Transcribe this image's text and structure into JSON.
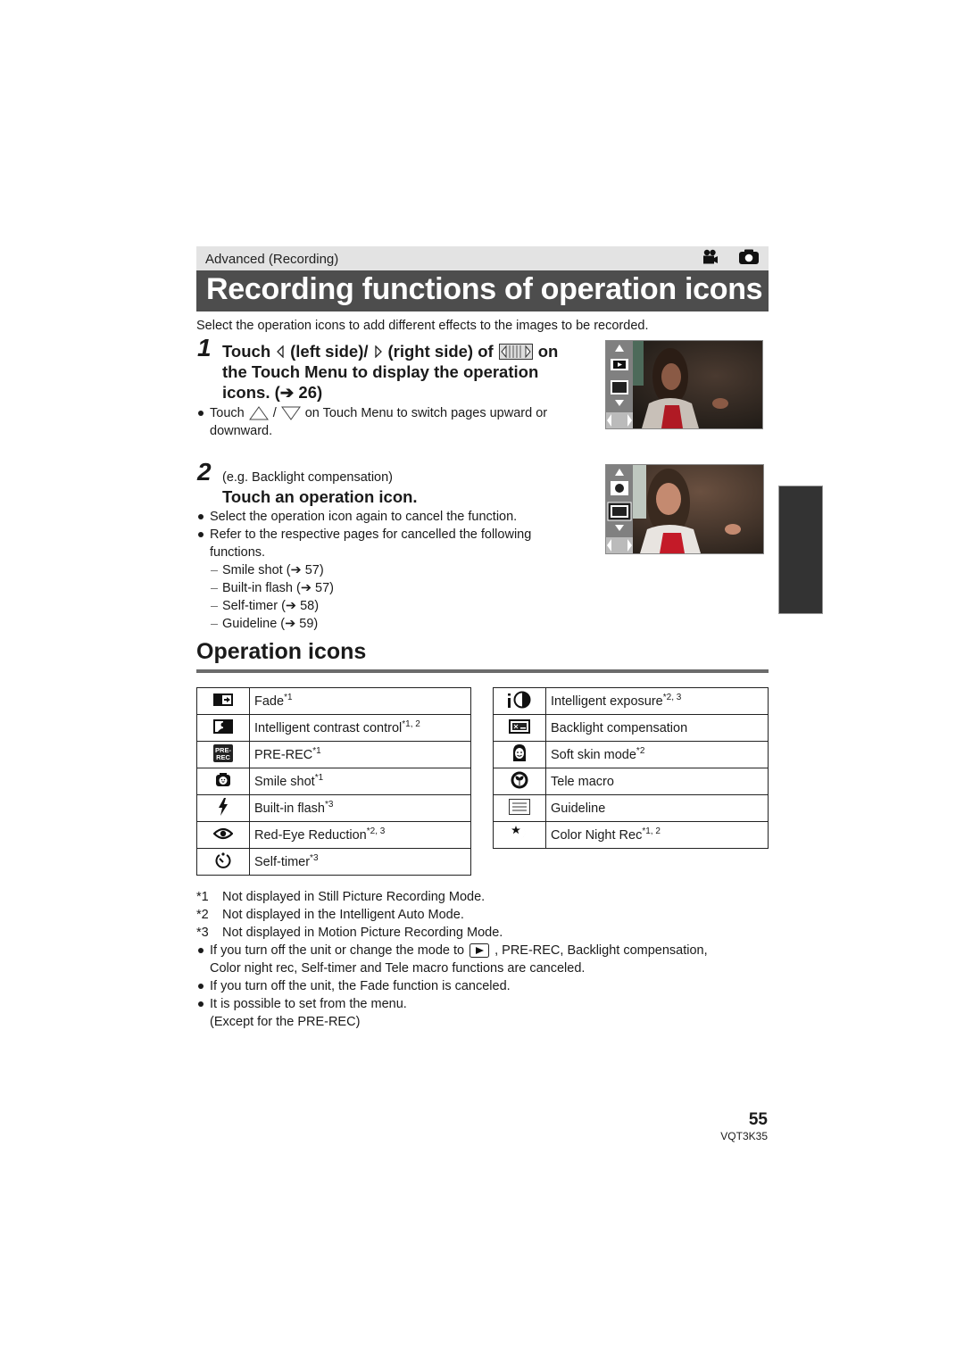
{
  "header": {
    "section": "Advanced (Recording)",
    "mode_icons": [
      "video-camera-icon",
      "still-camera-icon"
    ],
    "title": "Recording functions of operation icons",
    "intro": "Select the operation icons to add different effects to the images to be recorded."
  },
  "step1": {
    "number": "1",
    "line1_a": "Touch",
    "line1_b": "(left side)/",
    "line1_c": "(right side) of",
    "line1_d": "on",
    "line2": "the Touch Menu to display the operation",
    "line3": "icons. (➔ 26)",
    "note_a": "Touch",
    "note_b": "/",
    "note_c": "on Touch Menu to switch pages upward or",
    "note_d": "downward."
  },
  "step2": {
    "number": "2",
    "example": "(e.g. Backlight compensation)",
    "heading": "Touch an operation icon.",
    "bullets": [
      "Select the operation icon again to cancel the function.",
      "Refer to the respective pages for cancelled the following functions."
    ],
    "refs": [
      "Smile shot (➔ 57)",
      "Built-in flash (➔ 57)",
      "Self-timer (➔ 58)",
      "Guideline (➔ 59)"
    ]
  },
  "operation_icons": {
    "heading": "Operation icons",
    "left": [
      {
        "icon": "fade-icon",
        "label": "Fade",
        "note": "*1"
      },
      {
        "icon": "intelligent-contrast-icon",
        "label": "Intelligent contrast control",
        "note": "*1, 2"
      },
      {
        "icon": "pre-rec-icon",
        "label": "PRE-REC",
        "note": "*1"
      },
      {
        "icon": "smile-shot-icon",
        "label": "Smile shot",
        "note": "*1"
      },
      {
        "icon": "flash-icon",
        "label": "Built-in flash",
        "note": "*3"
      },
      {
        "icon": "red-eye-icon",
        "label": "Red-Eye Reduction",
        "note": "*2, 3"
      },
      {
        "icon": "self-timer-icon",
        "label": "Self-timer",
        "note": "*3"
      }
    ],
    "right": [
      {
        "icon": "intelligent-exposure-icon",
        "label": "Intelligent exposure",
        "note": "*2, 3"
      },
      {
        "icon": "backlight-icon",
        "label": "Backlight compensation",
        "note": ""
      },
      {
        "icon": "soft-skin-icon",
        "label": "Soft skin mode",
        "note": "*2"
      },
      {
        "icon": "tele-macro-icon",
        "label": "Tele macro",
        "note": ""
      },
      {
        "icon": "guideline-icon",
        "label": "Guideline",
        "note": ""
      },
      {
        "icon": "color-night-icon",
        "label": "Color Night Rec",
        "note": "*1, 2"
      }
    ]
  },
  "footnotes": [
    {
      "mark": "*1",
      "text": "Not displayed in Still Picture Recording Mode."
    },
    {
      "mark": "*2",
      "text": "Not displayed in the Intelligent Auto Mode."
    },
    {
      "mark": "*3",
      "text": "Not displayed in Motion Picture Recording Mode."
    }
  ],
  "notes": {
    "n1_a": "If you turn off the unit or change the mode to",
    "n1_b": ", PRE-REC, Backlight compensation,",
    "n1_c": "Color night rec, Self-timer and Tele macro functions are canceled.",
    "n2": "If you turn off the unit, the Fade function is canceled.",
    "n3_a": "It is possible to set from the menu.",
    "n3_b": "(Except for the PRE-REC)"
  },
  "footer": {
    "page": "55",
    "code": "VQT3K35"
  }
}
